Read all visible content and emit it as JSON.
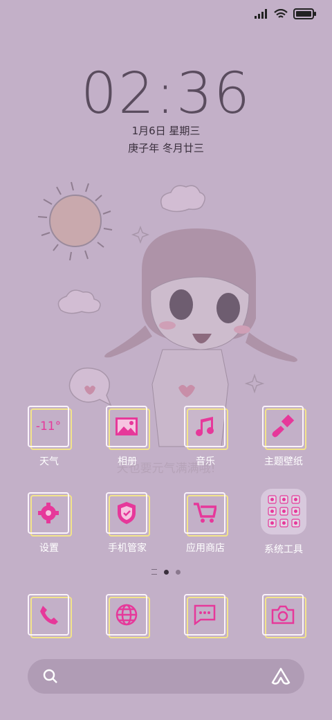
{
  "status_bar": {
    "signal_icon": "signal-icon",
    "wifi_icon": "wifi-icon",
    "battery_icon": "battery-icon"
  },
  "lock": {
    "time": "02:36",
    "date": "1月6日 星期三",
    "lunar": "庚子年 冬月廿三"
  },
  "apps_row1": [
    {
      "label": "天气",
      "icon": "weather-icon",
      "temp": "-11°"
    },
    {
      "label": "相册",
      "icon": "gallery-icon"
    },
    {
      "label": "音乐",
      "icon": "music-icon"
    },
    {
      "label": "主题壁纸",
      "icon": "theme-brush-icon"
    }
  ],
  "apps_row2": [
    {
      "label": "设置",
      "icon": "settings-gear-icon"
    },
    {
      "label": "手机管家",
      "icon": "security-shield-icon"
    },
    {
      "label": "应用商店",
      "icon": "store-cart-icon"
    },
    {
      "label": "系统工具",
      "icon": "folder-icon"
    }
  ],
  "wall_text": "天也要元气满满哦!",
  "dock": [
    {
      "icon": "phone-icon"
    },
    {
      "icon": "browser-globe-icon"
    },
    {
      "icon": "messages-icon"
    },
    {
      "icon": "camera-icon"
    }
  ],
  "search_bar": {
    "search_icon": "search-icon",
    "assistant_icon": "assistant-icon"
  },
  "colors": {
    "background": "#c3b0c8",
    "accent": "#e6389a",
    "frame_yellow": "#f3e48a"
  }
}
